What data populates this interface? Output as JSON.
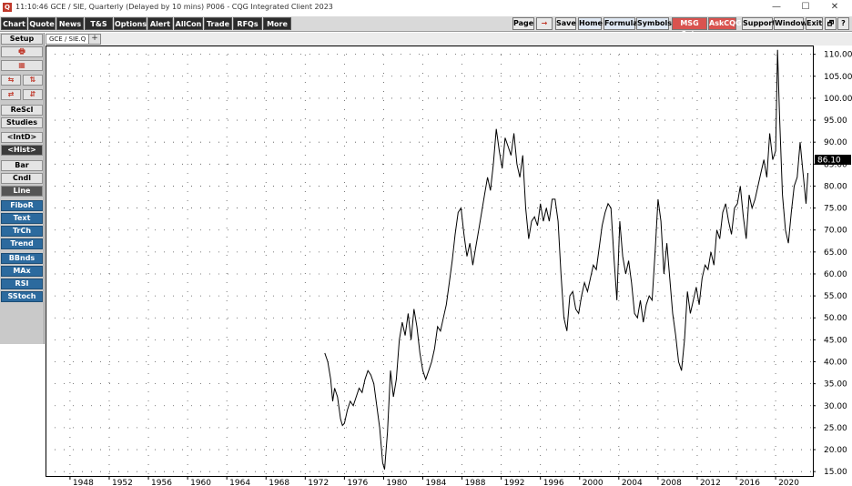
{
  "window": {
    "time": "11:10:46",
    "title": "GCE / SIE, Quarterly (Delayed by 10 mins)  P006 - CQG Integrated Client 2023",
    "minimize": "—",
    "maximize": "☐",
    "close": "✕"
  },
  "toolbar_left": [
    "Chart",
    "Quote",
    "News",
    "T&S",
    "Options",
    "Alert",
    "AllCon",
    "Trade",
    "RFQs",
    "More"
  ],
  "toolbar_right": {
    "page": "Page",
    "arrow": "→",
    "save": "Save",
    "home": "Home",
    "formula": "Formula",
    "symbols": "Symbols",
    "msg": "MSG Cntr",
    "askcqg": "AskCQG",
    "support": "Support",
    "window": "Window",
    "exit": "Exit",
    "icon1": "🗗",
    "icon2": "?"
  },
  "left_panel": {
    "setup": "Setup",
    "print_icon": "🖶",
    "calendar_icon": "▦",
    "rescl": "ReScl",
    "studies": "Studies",
    "intd": "<IntD>",
    "hist": "<Hist>",
    "bar": "Bar",
    "cndl": "Cndl",
    "line": "Line",
    "studies_list": [
      "FiboR",
      "Text",
      "TrCh",
      "Trend",
      "BBnds",
      "MAx",
      "RSI",
      "SStoch"
    ]
  },
  "tab": {
    "label": "GCE / SIE.Q",
    "add": "+"
  },
  "chart_data": {
    "type": "line",
    "symbol": "GCE / SIE",
    "period": "Quarterly",
    "last_value_label": "86.10",
    "ylim": [
      14,
      112
    ],
    "yticks": [
      15,
      20,
      25,
      30,
      35,
      40,
      45,
      50,
      55,
      60,
      65,
      70,
      75,
      80,
      85,
      90,
      95,
      100,
      105,
      110
    ],
    "ytick_labels": [
      "15.00",
      "20.00",
      "25.00",
      "30.00",
      "35.00",
      "40.00",
      "45.00",
      "50.00",
      "55.00",
      "60.00",
      "65.00",
      "70.00",
      "75.00",
      "80.00",
      "85.00",
      "90.00",
      "95.00",
      "100.00",
      "105.00",
      "110.00"
    ],
    "xlim": [
      1945.5,
      2023.8
    ],
    "xticks": [
      1948,
      1952,
      1956,
      1960,
      1964,
      1968,
      1972,
      1976,
      1980,
      1984,
      1988,
      1992,
      1996,
      2000,
      2004,
      2008,
      2012,
      2016,
      2020
    ],
    "grid": true,
    "x": [
      1974.0,
      1974.3,
      1974.6,
      1974.8,
      1975.0,
      1975.3,
      1975.6,
      1975.8,
      1976.0,
      1976.3,
      1976.6,
      1976.9,
      1977.2,
      1977.5,
      1977.8,
      1978.1,
      1978.4,
      1978.7,
      1979.0,
      1979.3,
      1979.6,
      1979.9,
      1980.1,
      1980.4,
      1980.7,
      1981.0,
      1981.3,
      1981.6,
      1981.9,
      1982.2,
      1982.5,
      1982.8,
      1983.1,
      1983.4,
      1983.7,
      1984.0,
      1984.3,
      1984.6,
      1984.9,
      1985.2,
      1985.5,
      1985.8,
      1986.1,
      1986.4,
      1986.7,
      1987.0,
      1987.3,
      1987.6,
      1987.9,
      1988.2,
      1988.5,
      1988.8,
      1989.1,
      1989.4,
      1989.7,
      1990.0,
      1990.3,
      1990.6,
      1990.9,
      1991.2,
      1991.5,
      1991.8,
      1992.1,
      1992.4,
      1992.7,
      1993.0,
      1993.3,
      1993.6,
      1993.9,
      1994.2,
      1994.5,
      1994.8,
      1995.1,
      1995.4,
      1995.7,
      1996.0,
      1996.3,
      1996.6,
      1996.9,
      1997.2,
      1997.5,
      1997.8,
      1998.1,
      1998.4,
      1998.7,
      1999.0,
      1999.3,
      1999.6,
      1999.9,
      2000.2,
      2000.5,
      2000.8,
      2001.1,
      2001.4,
      2001.7,
      2002.0,
      2002.3,
      2002.6,
      2002.9,
      2003.2,
      2003.5,
      2003.8,
      2004.1,
      2004.4,
      2004.7,
      2005.0,
      2005.3,
      2005.6,
      2005.9,
      2006.2,
      2006.5,
      2006.8,
      2007.1,
      2007.4,
      2007.7,
      2008.0,
      2008.3,
      2008.6,
      2008.9,
      2009.2,
      2009.5,
      2009.8,
      2010.1,
      2010.4,
      2010.7,
      2011.0,
      2011.3,
      2011.6,
      2011.9,
      2012.2,
      2012.5,
      2012.8,
      2013.1,
      2013.4,
      2013.7,
      2014.0,
      2014.3,
      2014.6,
      2014.9,
      2015.2,
      2015.5,
      2015.8,
      2016.1,
      2016.4,
      2016.7,
      2017.0,
      2017.3,
      2017.6,
      2017.9,
      2018.2,
      2018.5,
      2018.8,
      2019.1,
      2019.4,
      2019.7,
      2020.0,
      2020.2,
      2020.4,
      2020.7,
      2021.0,
      2021.3,
      2021.6,
      2021.9,
      2022.2,
      2022.5,
      2022.8,
      2023.1,
      2023.3
    ],
    "values": [
      42,
      40,
      36,
      31,
      34,
      32,
      27,
      25.5,
      26,
      29,
      31,
      30,
      32,
      34,
      33,
      36,
      38,
      37,
      35,
      30,
      25,
      17,
      15.5,
      24,
      38,
      32,
      36,
      45,
      49,
      46,
      51,
      45,
      52,
      48,
      42,
      38,
      36,
      38,
      40,
      43,
      48,
      47,
      50,
      53,
      58,
      63,
      69,
      74,
      75,
      69,
      64,
      67,
      62,
      66,
      70,
      74,
      78,
      82,
      79,
      85,
      93,
      88,
      84,
      91,
      89,
      87,
      92,
      85,
      82,
      87,
      75,
      68,
      72,
      73,
      71,
      76,
      72,
      75,
      72,
      77,
      77,
      72,
      60,
      50,
      47,
      55,
      56,
      52,
      51,
      55,
      58,
      56,
      59,
      62,
      61,
      66,
      71,
      74,
      76,
      75,
      64,
      54,
      72,
      64,
      60,
      63,
      58,
      51,
      50,
      54,
      49,
      53,
      55,
      54,
      65,
      77,
      72,
      60,
      67,
      59,
      51,
      46,
      40,
      38,
      45,
      56,
      51,
      54,
      57,
      53,
      59,
      62,
      61,
      65,
      62,
      70,
      68,
      74,
      76,
      72,
      69,
      75,
      76,
      80,
      73,
      68,
      78,
      75,
      77,
      80,
      83,
      86,
      82,
      92,
      86,
      88,
      111,
      96,
      78,
      70,
      67,
      74,
      80,
      82,
      90,
      83,
      76,
      83,
      85,
      82,
      86,
      86
    ]
  }
}
